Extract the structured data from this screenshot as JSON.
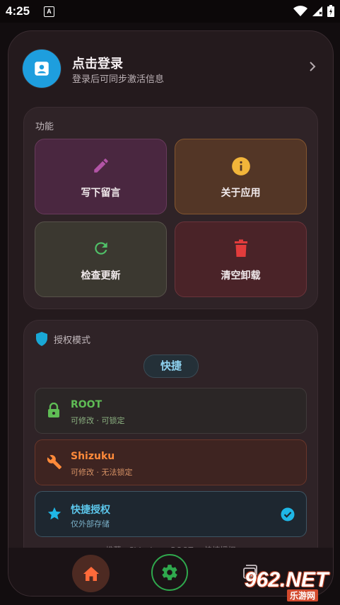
{
  "status_bar": {
    "time": "4:25",
    "notif_letter": "A"
  },
  "profile": {
    "title": "点击登录",
    "subtitle": "登录后可同步激活信息"
  },
  "features": {
    "title": "功能",
    "tiles": [
      {
        "label": "写下留言",
        "icon": "pencil-icon",
        "color": "#b254a6"
      },
      {
        "label": "关于应用",
        "icon": "info-icon",
        "color": "#f2b53a"
      },
      {
        "label": "检查更新",
        "icon": "refresh-icon",
        "color": "#50c168"
      },
      {
        "label": "清空卸载",
        "icon": "trash-icon",
        "color": "#e23c3c"
      }
    ]
  },
  "auth": {
    "title": "授权模式",
    "chip": "快捷",
    "options": [
      {
        "name": "ROOT",
        "desc": "可修改 · 可锁定",
        "icon": "lock-icon"
      },
      {
        "name": "Shizuku",
        "desc": "可修改 · 无法锁定",
        "icon": "wrench-icon"
      },
      {
        "name": "快捷授权",
        "desc": "仅外部存储",
        "icon": "star-icon",
        "selected": true
      }
    ],
    "recommend": "推荐：Shizuku > ROOT > 快捷授权"
  },
  "nav": {
    "items": [
      "home-icon",
      "gear-icon",
      "image-icon"
    ]
  },
  "watermark": {
    "main": "962.NET",
    "sub": "乐游网"
  }
}
